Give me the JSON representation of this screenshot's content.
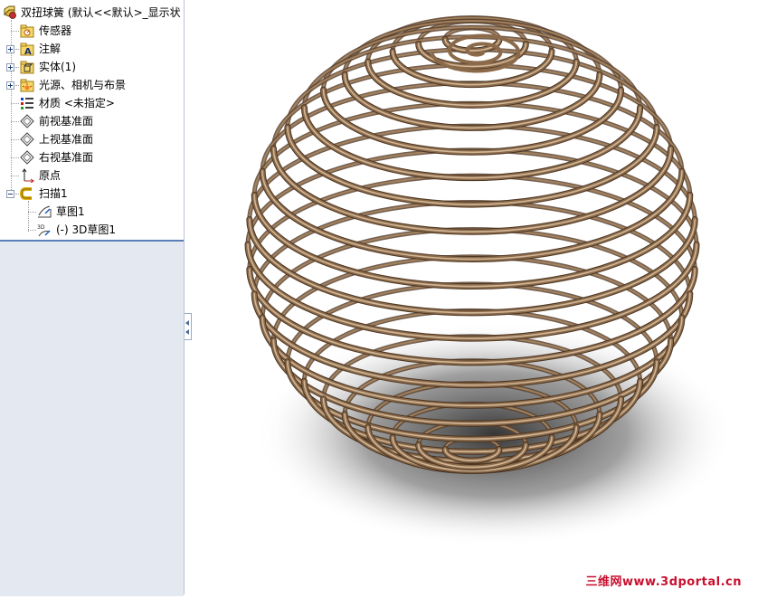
{
  "feature_tree": {
    "root": {
      "label": "双扭球簧 (默认<<默认>_显示状",
      "icon": "part-icon"
    },
    "items": [
      {
        "label": "传感器",
        "icon": "sensors-folder-icon",
        "expandable": false
      },
      {
        "label": "注解",
        "icon": "annotations-folder-icon",
        "expandable": true
      },
      {
        "label": "实体(1)",
        "icon": "solid-bodies-folder-icon",
        "expandable": true
      },
      {
        "label": "光源、相机与布景",
        "icon": "lights-cameras-scene-icon",
        "expandable": true
      },
      {
        "label": "材质 <未指定>",
        "icon": "material-icon",
        "expandable": false
      },
      {
        "label": "前视基准面",
        "icon": "plane-icon",
        "expandable": false
      },
      {
        "label": "上视基准面",
        "icon": "plane-icon",
        "expandable": false
      },
      {
        "label": "右视基准面",
        "icon": "plane-icon",
        "expandable": false
      },
      {
        "label": "原点",
        "icon": "origin-icon",
        "expandable": false
      },
      {
        "label": "扫描1",
        "icon": "sweep-feature-icon",
        "expandable": true,
        "expanded": true
      }
    ],
    "children": [
      {
        "label": "草图1",
        "icon": "sketch-icon"
      },
      {
        "label": "(-) 3D草图1",
        "icon": "3d-sketch-icon"
      }
    ]
  },
  "viewport": {
    "model": "double-torsion-spherical-spring",
    "coil_color": "#8b6a4a",
    "background": "#ffffff"
  },
  "watermark": {
    "text": "三维网www.3dportal.cn",
    "color": "#c8102e"
  }
}
